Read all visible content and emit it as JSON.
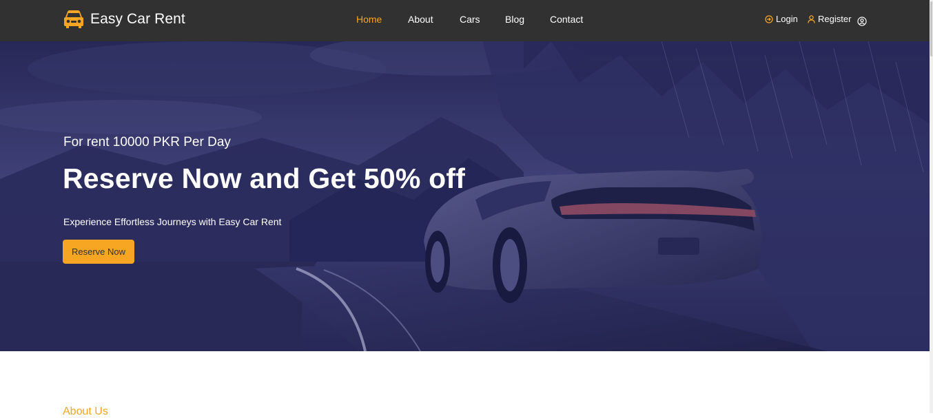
{
  "brand": {
    "name": "Easy Car Rent",
    "icon": "car-icon",
    "icon_color": "#f6a623"
  },
  "nav": {
    "links": [
      {
        "label": "Home",
        "active": true
      },
      {
        "label": "About",
        "active": false
      },
      {
        "label": "Cars",
        "active": false
      },
      {
        "label": "Blog",
        "active": false
      },
      {
        "label": "Contact",
        "active": false
      }
    ]
  },
  "auth": {
    "login_label": "Login",
    "login_icon": "login-icon",
    "register_label": "Register",
    "register_icon": "user-icon",
    "account_icon": "account-circle-icon"
  },
  "hero": {
    "subtitle": "For rent 10000 PKR Per Day",
    "title": "Reserve Now and Get 50% off",
    "description": "Experience Effortless Journeys with Easy Car Rent",
    "button_label": "Reserve Now"
  },
  "about": {
    "label": "About Us"
  },
  "colors": {
    "accent": "#f6a623",
    "navbar": "#313131",
    "hero_tint": "#2e2f63"
  }
}
